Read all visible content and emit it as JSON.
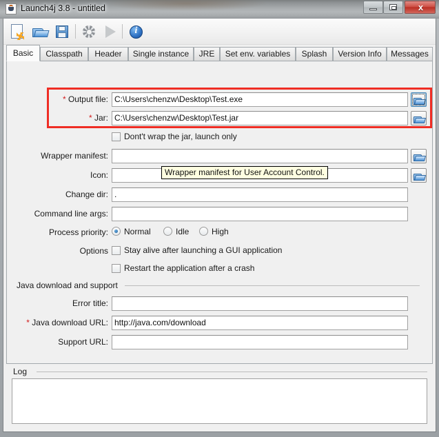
{
  "window": {
    "title": "Launch4j 3.8 - untitled",
    "app_icon": "java-cup-icon",
    "controls": {
      "minimize": "minimize-icon",
      "maximize": "maximize-icon",
      "close": "x"
    }
  },
  "toolbar": {
    "items": [
      {
        "name": "new-file-button",
        "icon": "new-file-icon"
      },
      {
        "name": "open-file-button",
        "icon": "open-folder-icon"
      },
      {
        "name": "save-file-button",
        "icon": "save-disk-icon"
      },
      {
        "name": "build-settings-button",
        "icon": "gear-icon"
      },
      {
        "name": "run-button",
        "icon": "play-icon"
      },
      {
        "name": "about-button",
        "icon": "info-icon"
      }
    ]
  },
  "tabs": [
    {
      "label": "Basic",
      "active": true
    },
    {
      "label": "Classpath",
      "active": false
    },
    {
      "label": "Header",
      "active": false
    },
    {
      "label": "Single instance",
      "active": false
    },
    {
      "label": "JRE",
      "active": false
    },
    {
      "label": "Set env. variables",
      "active": false
    },
    {
      "label": "Splash",
      "active": false
    },
    {
      "label": "Version Info",
      "active": false
    },
    {
      "label": "Messages",
      "active": false
    }
  ],
  "basic": {
    "output_file": {
      "label": "Output file:",
      "required": "*",
      "value": "C:\\Users\\chenzw\\Desktop\\Test.exe",
      "browse": "browse-folder-icon"
    },
    "jar": {
      "label": "Jar:",
      "required": "*",
      "value": "C:\\Users\\chenzw\\Desktop\\Test.jar",
      "browse": "browse-folder-icon"
    },
    "dont_wrap": {
      "label": "Dont't wrap the jar, launch only",
      "checked": false
    },
    "wrapper_manifest": {
      "label": "Wrapper manifest:",
      "value": "",
      "browse": "browse-folder-icon"
    },
    "icon": {
      "label": "Icon:",
      "value": "",
      "browse": "browse-folder-icon"
    },
    "change_dir": {
      "label": "Change dir:",
      "value": "."
    },
    "command_line_args": {
      "label": "Command line args:",
      "value": ""
    },
    "process_priority": {
      "label": "Process priority:",
      "options": [
        {
          "label": "Normal",
          "selected": true
        },
        {
          "label": "Idle",
          "selected": false
        },
        {
          "label": "High",
          "selected": false
        }
      ]
    },
    "options": {
      "label": "Options",
      "items": [
        {
          "label": "Stay alive after launching a GUI application",
          "checked": false
        },
        {
          "label": "Restart the application after a crash",
          "checked": false
        }
      ]
    },
    "java_group": {
      "title": "Java download and support",
      "error_title": {
        "label": "Error title:",
        "value": ""
      },
      "java_download_url": {
        "label": "Java download URL:",
        "required": "*",
        "value": "http://java.com/download"
      },
      "support_url": {
        "label": "Support URL:",
        "value": ""
      }
    }
  },
  "tooltip": {
    "text": "Wrapper manifest for User Account Control."
  },
  "log": {
    "title": "Log",
    "content": ""
  },
  "colors": {
    "required_asterisk": "#d21b1b",
    "highlight_box": "#ef2d24",
    "tooltip_bg": "#ffffe1",
    "panel_bg": "#f0f0f0",
    "close_button": "#bb2f24"
  }
}
